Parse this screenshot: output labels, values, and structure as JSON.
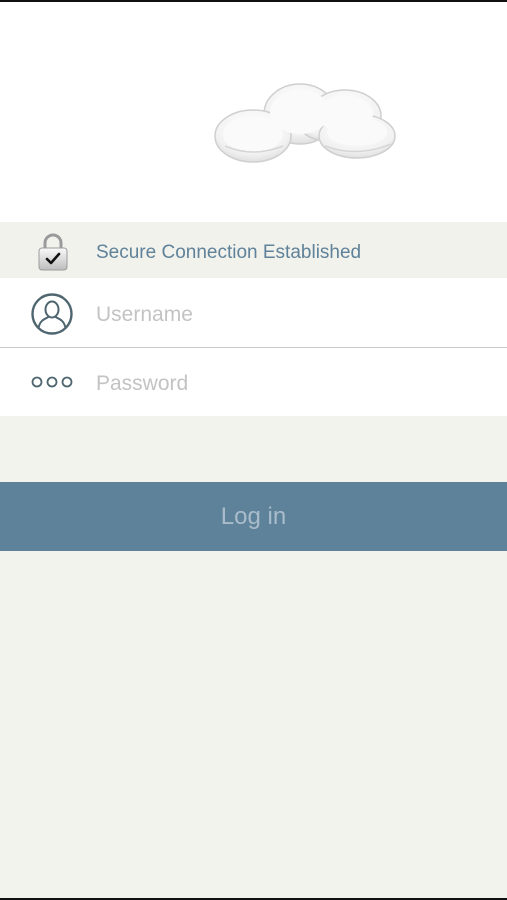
{
  "security": {
    "status_text": "Secure Connection Established",
    "icon": "padlock-check-icon"
  },
  "login_form": {
    "username": {
      "placeholder": "Username",
      "value": "",
      "icon": "user-icon"
    },
    "password": {
      "placeholder": "Password",
      "value": "",
      "icon": "dots-icon"
    },
    "submit_label": "Log in"
  },
  "logo": {
    "icon": "cloud-icon"
  },
  "colors": {
    "accent": "#5e8299",
    "accent_text": "#a9bccb",
    "status_text": "#5f8299",
    "background": "#f3f3ee",
    "placeholder": "#c3c3c3"
  }
}
